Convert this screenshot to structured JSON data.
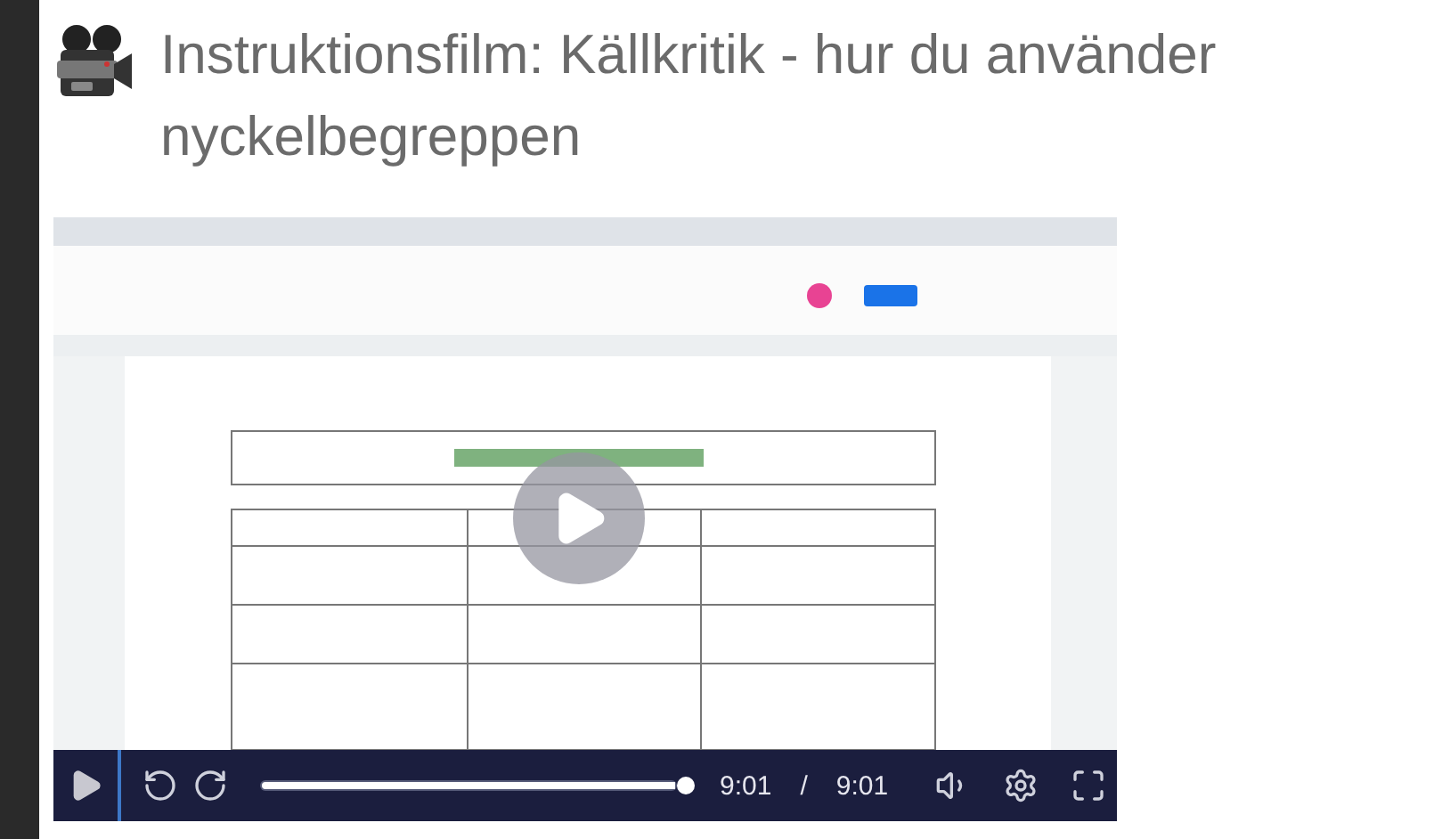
{
  "title": "Instruktionsfilm: Källkritik - hur du använder nyckelbegreppen",
  "video": {
    "kind": "picture",
    "playing": false,
    "progress": {
      "level": 1
    },
    "current_time": "9:01",
    "separator": "/",
    "duration": "9:01"
  }
}
